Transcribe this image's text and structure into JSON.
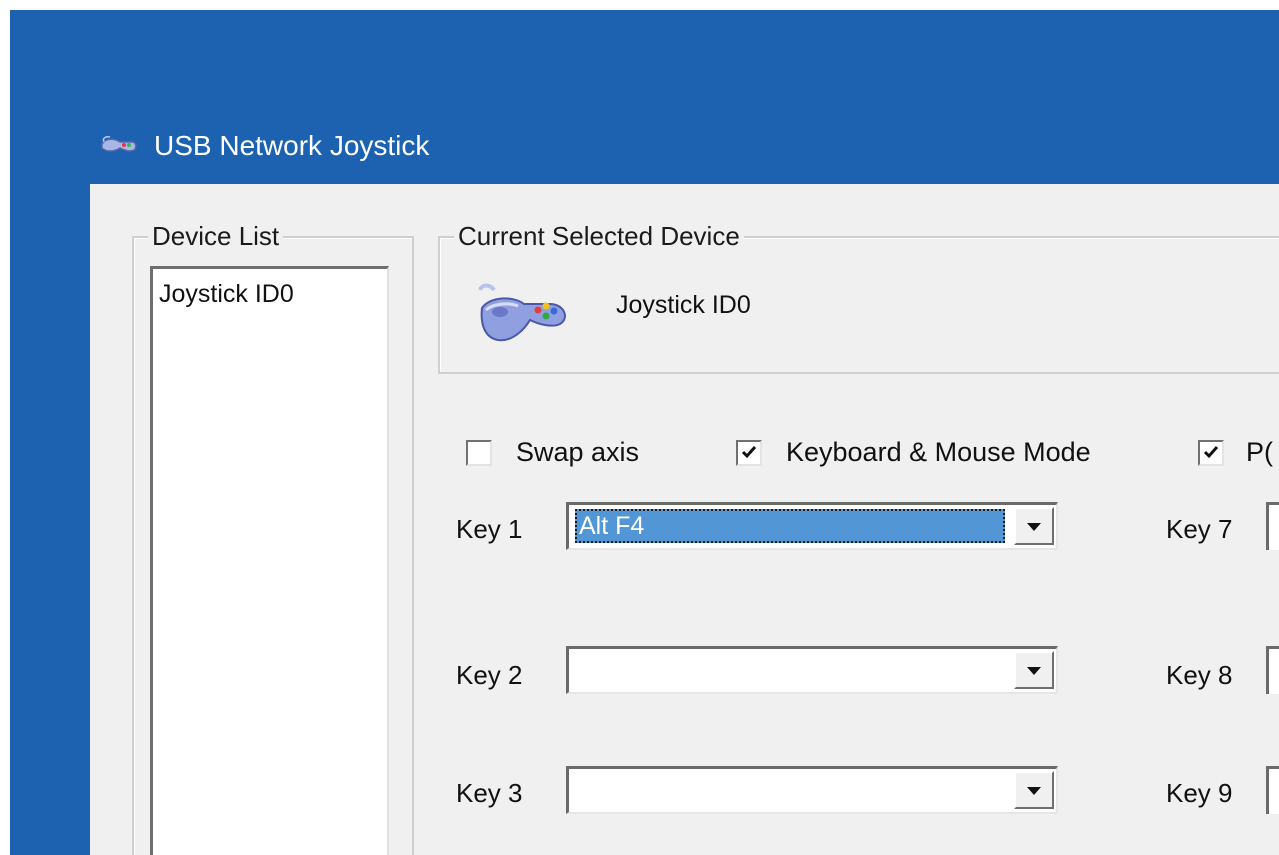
{
  "window": {
    "title": "USB Network Joystick",
    "title_icon": "joystick-icon"
  },
  "device_list": {
    "legend": "Device List",
    "items": [
      "Joystick ID0"
    ]
  },
  "current_device": {
    "legend": "Current Selected Device",
    "name": "Joystick ID0",
    "icon": "joystick-icon"
  },
  "options": {
    "swap_axis": {
      "label": "Swap axis",
      "checked": false
    },
    "keyboard_mouse_mode": {
      "label": "Keyboard & Mouse Mode",
      "checked": true
    },
    "third": {
      "label": "P(",
      "checked": true
    }
  },
  "keys": {
    "key1": {
      "label": "Key 1",
      "value": "Alt F4"
    },
    "key2": {
      "label": "Key 2",
      "value": ""
    },
    "key3": {
      "label": "Key 3",
      "value": ""
    },
    "key7": {
      "label": "Key 7"
    },
    "key8": {
      "label": "Key 8"
    },
    "key9": {
      "label": "Key 9"
    }
  },
  "colors": {
    "title_bar": "#1c62b0",
    "selection": "#5296d6",
    "window_bg": "#f0f0f0"
  }
}
